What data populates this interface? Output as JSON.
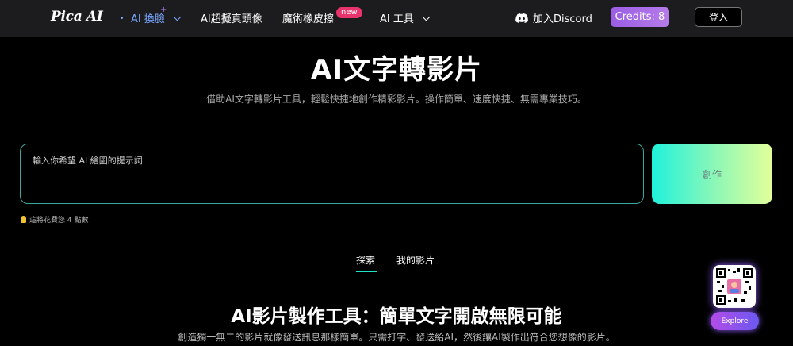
{
  "nav": {
    "logo": "Pica AI",
    "items": [
      {
        "label": "AI 換臉",
        "sparkle": "+"
      },
      {
        "label": "AI超擬真頭像"
      },
      {
        "label": "魔術橡皮擦",
        "badge": "new"
      },
      {
        "label": "AI 工具"
      }
    ],
    "discord_label": "加入Discord",
    "credits_label": "Credits: 8",
    "login_label": "登入"
  },
  "hero": {
    "title": "AI文字轉影片",
    "subtitle": "借助AI文字轉影片工具，輕鬆快捷地創作精彩影片。操作簡單、速度快捷、無需專業技巧。",
    "prompt_placeholder": "輸入你希望 AI 繪圖的提示詞",
    "create_label": "創作",
    "cost_note": "這將花費您 4 點數"
  },
  "tabs": [
    {
      "label": "探索",
      "active": true
    },
    {
      "label": "我的影片",
      "active": false
    }
  ],
  "section": {
    "title": "AI影片製作工具：簡單文字開啟無限可能",
    "subtitle": "創造獨一無二的影片就像發送訊息那樣簡單。只需打字、發送給AI，然後讓AI製作出符合您想像的影片。"
  },
  "widget": {
    "explore_label": "Explore"
  },
  "colors": {
    "nav_bg": "#1c1c1e",
    "accent_teal": "#1fe3c7",
    "credits_purple": "#9b5de5",
    "badge_pink": "#e8336d"
  }
}
